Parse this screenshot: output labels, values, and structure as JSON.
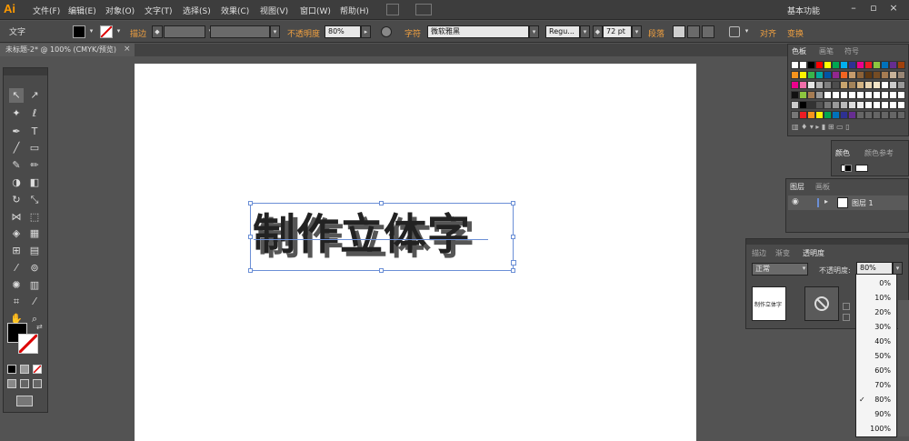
{
  "app": {
    "logo": "Ai"
  },
  "menu": {
    "items": [
      "文件(F)",
      "编辑(E)",
      "对象(O)",
      "文字(T)",
      "选择(S)",
      "效果(C)",
      "视图(V)",
      "窗口(W)",
      "帮助(H)"
    ],
    "workspace": "基本功能"
  },
  "control": {
    "tool_name": "文字",
    "stroke_label": "描边",
    "opacity_label": "不透明度",
    "opacity_value": "80%",
    "char_label": "字符",
    "font_name": "微软雅黑",
    "font_style": "Regu...",
    "font_size": "72 pt",
    "paragraph_label": "段落",
    "align_label": "对齐",
    "transform_label": "变换"
  },
  "document": {
    "tab_title": "未标题-2* @ 100% (CMYK/预览)"
  },
  "artwork": {
    "text": "制作立体字"
  },
  "panels": {
    "swatches_tabs": [
      "色板",
      "画笔",
      "符号"
    ],
    "color_tabs": [
      "颜色",
      "颜色参考"
    ],
    "layers_tabs": [
      "图层",
      "画板"
    ],
    "layer_name": "图层 1",
    "transparency_tabs": [
      "描边",
      "渐变",
      "透明度"
    ],
    "blend_mode": "正常",
    "opacity_label": "不透明度:",
    "opacity_value": "80%",
    "thumb_text": "制作立体字",
    "opacity_options": [
      "0%",
      "10%",
      "20%",
      "30%",
      "40%",
      "50%",
      "60%",
      "70%",
      "80%",
      "90%",
      "100%"
    ],
    "opacity_selected": "80%"
  },
  "colors": {
    "accent_orange": "#f0a040",
    "selection_blue": "#6b8fd6"
  }
}
